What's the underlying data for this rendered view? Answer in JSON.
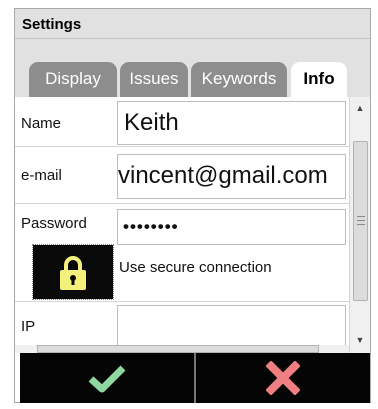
{
  "window": {
    "title": "Settings"
  },
  "tabs": [
    {
      "label": "Display",
      "active": false
    },
    {
      "label": "Issues",
      "active": false
    },
    {
      "label": "Keywords",
      "active": false
    },
    {
      "label": "Info",
      "active": true
    }
  ],
  "form": {
    "name": {
      "label": "Name",
      "value": "Keith"
    },
    "email": {
      "label": "e-mail",
      "value": "vincent@gmail.com"
    },
    "password": {
      "label": "Password",
      "value": "••••••••"
    },
    "secure": {
      "label": "Use secure connection",
      "icon": "lock-icon"
    },
    "ip": {
      "label": "IP",
      "value": ""
    }
  },
  "actions": {
    "ok_icon": "checkmark-icon",
    "cancel_icon": "cross-icon"
  },
  "colors": {
    "tab_inactive": "#8d8d8d",
    "tab_active": "#ffffff",
    "action_bar": "#050505",
    "ok_green": "#8fd6a0",
    "cancel_pink": "#f07f82",
    "lock_yellow": "#f4f07c"
  }
}
